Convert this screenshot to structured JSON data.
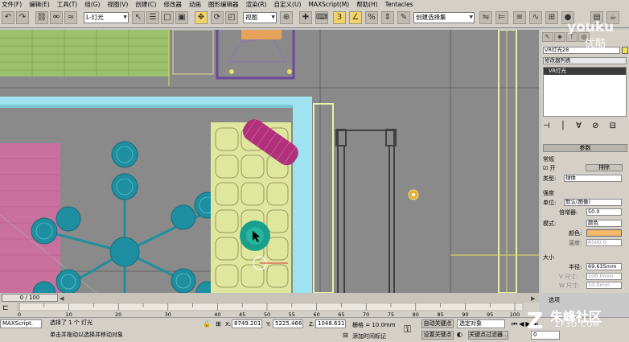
{
  "menu": [
    "文件(F)",
    "编辑(E)",
    "工具(T)",
    "组(G)",
    "视图(V)",
    "创建(C)",
    "修改器",
    "动画",
    "图形编辑器",
    "渲染(R)",
    "自定义(U)",
    "MAXScript(M)",
    "帮助(H)",
    "Tentacles"
  ],
  "toolbar": {
    "selection_set": "L-灯光",
    "coord_system": "视图",
    "named_selection": "创建选择集"
  },
  "panel": {
    "object_name": "VR灯光28",
    "modifier_list": "修改器列表",
    "stack_item": "VR灯光",
    "params_title": "参数",
    "general_label": "常规",
    "on_label": "开",
    "exclude_button": "排除",
    "type_label": "类型:",
    "type_value": "球体",
    "intensity_label": "强度",
    "units_label": "单位:",
    "units_value": "默认(图像)",
    "multiplier_label": "倍增器:",
    "multiplier_value": "50.0",
    "mode_label": "模式:",
    "mode_value": "颜色",
    "color_label": "颜色:",
    "color_swatch": "#f7b86a",
    "temperature_label": "温度:",
    "temperature_value": "6500.0",
    "size_label": "大小",
    "radius_label": "半径:",
    "radius_value": "69.635mm",
    "vsize_label": "V 尺寸:",
    "vsize_value": "100.0mm",
    "wsize_label": "W 尺寸:",
    "wsize_value": "10.0mm",
    "options_label": "选项"
  },
  "timeline": {
    "frame_display": "0 / 100",
    "ticks": [
      "0",
      "10",
      "20",
      "30",
      "40",
      "45",
      "50",
      "55",
      "60",
      "65",
      "70",
      "75",
      "80",
      "85",
      "90",
      "95",
      "100"
    ]
  },
  "status": {
    "maxscript_label": "MAXScript.",
    "selection_info": "选择了 1 个 灯光",
    "prompt": "单击并拖动以选择并移动对象",
    "x_label": "X:",
    "x_value": "8749.201n",
    "y_label": "Y:",
    "y_value": "5225.466n",
    "z_label": "Z:",
    "z_value": "1048.631n",
    "grid_label": "栅格 = 10.0mm",
    "add_time_tag": "添加时间标记",
    "auto_key": "自动关键点",
    "set_key": "设置关键点",
    "selected_object": "选定对象",
    "key_filters": "关键点过滤器...",
    "frame_value": "0"
  },
  "watermarks": {
    "youku": "youku",
    "youku_cn": "优酷",
    "zhufeng": "朱峰社区",
    "zf3d": "ZF3D.COM"
  },
  "colors": {
    "viewport_bg": "#8a8a8a",
    "wall_cyan": "#9fe3f0",
    "wire_yellow": "#e9f0a8",
    "chandelier": "#1e8fa0",
    "magenta": "#c0307a",
    "active_tool": "#f2d36a"
  }
}
